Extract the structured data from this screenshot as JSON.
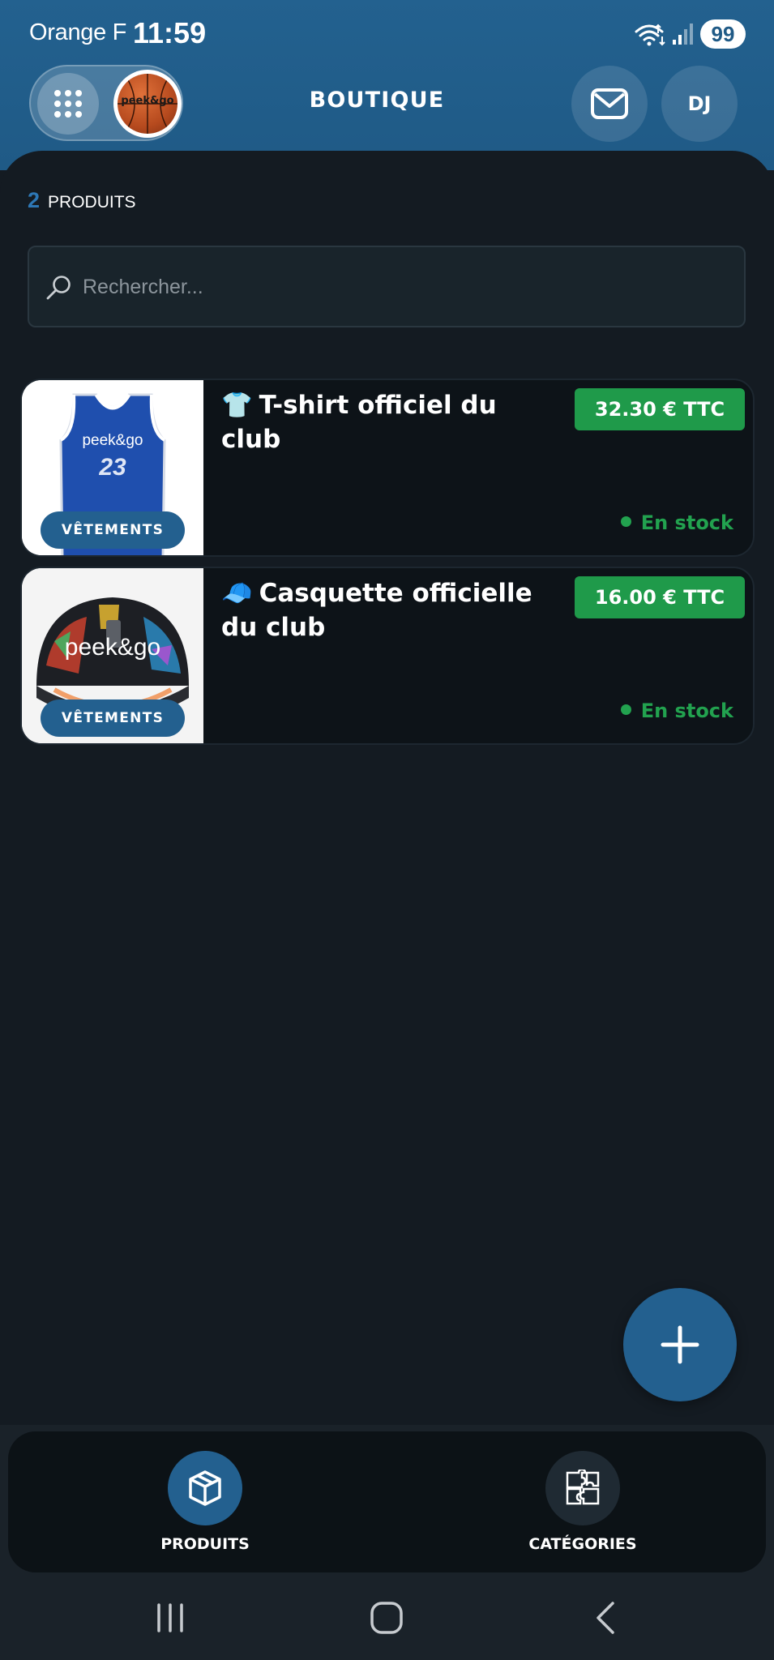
{
  "status_bar": {
    "carrier": "Orange F",
    "time": "11:59",
    "battery": "99"
  },
  "header": {
    "title": "BOUTIQUE",
    "logo_text": "peek&go",
    "avatar_initials": "DJ"
  },
  "products_count": {
    "number": "2",
    "label": "PRODUITS"
  },
  "search": {
    "placeholder": "Rechercher...",
    "value": ""
  },
  "products": [
    {
      "emoji": "👕",
      "title": "T-shirt officiel du club",
      "price": "32.30 € TTC",
      "category": "VÊTEMENTS",
      "stock": "En stock",
      "image_text": "peek&go",
      "jersey_number": "23"
    },
    {
      "emoji": "🧢",
      "title": "Casquette officielle du club",
      "price": "16.00 € TTC",
      "category": "VÊTEMENTS",
      "stock": "En stock",
      "image_text": "peek&go"
    }
  ],
  "bottom_nav": {
    "items": [
      {
        "label": "PRODUITS",
        "icon": "box-icon",
        "active": true
      },
      {
        "label": "CATÉGORIES",
        "icon": "puzzle-icon",
        "active": false
      }
    ]
  },
  "colors": {
    "header": "#1f5a86",
    "accent": "#23608f",
    "price": "#1f9a4a",
    "stock": "#22a24f",
    "background": "#141b22"
  }
}
